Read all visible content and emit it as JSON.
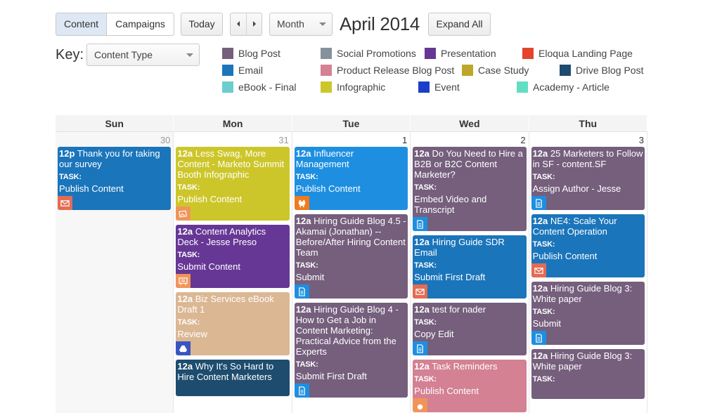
{
  "toolbar": {
    "view_tabs": [
      "Content",
      "Campaigns"
    ],
    "active_tab": "Content",
    "today_label": "Today",
    "prev_icon": "chevron-left-icon",
    "next_icon": "chevron-right-icon",
    "view_select": "Month",
    "period_title": "April 2014",
    "expand_label": "Expand All"
  },
  "key": {
    "label": "Key:",
    "select_value": "Content Type",
    "items": [
      {
        "label": "Blog Post",
        "color": "#755f7d"
      },
      {
        "label": "Email",
        "color": "#1b75bb"
      },
      {
        "label": "eBook - Final",
        "color": "#6ccdcf"
      },
      {
        "label": "Social Promotions",
        "color": "#85929c"
      },
      {
        "label": "Product Release Blog Post",
        "color": "#d38193"
      },
      {
        "label": "Infographic",
        "color": "#cdc62a"
      },
      {
        "label": "Presentation",
        "color": "#663795"
      },
      {
        "label": "Case Study",
        "color": "#bea62a"
      },
      {
        "label": "Event",
        "color": "#1c3ec9"
      },
      {
        "label": "Eloqua Landing Page",
        "color": "#e3452c"
      },
      {
        "label": "Drive Blog Post",
        "color": "#1d4c6e"
      },
      {
        "label": "Academy - Article",
        "color": "#62dec3"
      }
    ]
  },
  "calendar": {
    "days": [
      "Sun",
      "Mon",
      "Tue",
      "Wed",
      "Thu"
    ],
    "columns": [
      {
        "date": "30",
        "prev_month": true,
        "events": [
          {
            "time": "12p",
            "title": "Thank you for taking our survey",
            "task_label": "TASK:",
            "task": "Publish Content",
            "color": "#1b75bb",
            "icon": "email-icon",
            "icon_color": "#e36c54"
          }
        ]
      },
      {
        "date": "31",
        "prev_month": true,
        "events": [
          {
            "time": "12a",
            "title": "Less Swag, More Content - Marketo Summit Booth Infographic",
            "task_label": "TASK:",
            "task": "Publish Content",
            "color": "#cdc62a",
            "icon": "image-icon",
            "icon_color": "#f0955a"
          },
          {
            "time": "12a",
            "title": "Content Analytics Deck - Jesse Preso",
            "task_label": "TASK:",
            "task": "Submit Content",
            "color": "#663795",
            "icon": "presentation-icon",
            "icon_color": "#f0955a"
          },
          {
            "time": "12a",
            "title": "Biz Services eBook Draft 1",
            "task_label": "TASK:",
            "task": "Review",
            "color": "#dbb794",
            "icon": "google-drive-icon",
            "icon_color": "#3a55c2"
          },
          {
            "time": "12a",
            "title": "Why It's So Hard to Hire Content Marketers",
            "task_label": "",
            "task": "",
            "color": "#1d4c6e",
            "icon": "",
            "icon_color": ""
          }
        ]
      },
      {
        "date": "1",
        "prev_month": false,
        "events": [
          {
            "time": "12a",
            "title": "Influencer Management",
            "task_label": "TASK:",
            "task": "Publish Content",
            "color": "#1e8fe0",
            "icon": "social-icon",
            "icon_color": "#f07a1e"
          },
          {
            "time": "12a",
            "title": "Hiring Guide Blog 4.5 - Akamai (Jonathan) -- Before/After Hiring Content Team",
            "task_label": "TASK:",
            "task": "Submit",
            "color": "#755f7d",
            "icon": "document-icon",
            "icon_color": "#1e8fe0"
          },
          {
            "time": "12a",
            "title": "Hiring Guide Blog 4 - How to Get a Job in Content Marketing: Practical Advice from the Experts",
            "task_label": "TASK:",
            "task": "Submit First Draft",
            "color": "#755f7d",
            "icon": "document-icon",
            "icon_color": "#1e8fe0"
          }
        ]
      },
      {
        "date": "2",
        "prev_month": false,
        "events": [
          {
            "time": "12a",
            "title": "Do You Need to Hire a B2B or B2C Content Marketer?",
            "task_label": "TASK:",
            "task": "Embed Video and Transcript",
            "color": "#755f7d",
            "icon": "document-icon",
            "icon_color": "#1e8fe0"
          },
          {
            "time": "12a",
            "title": "Hiring Guide SDR Email",
            "task_label": "TASK:",
            "task": "Submit First Draft",
            "color": "#1b75bb",
            "icon": "email-icon",
            "icon_color": "#e36c54"
          },
          {
            "time": "12a",
            "title": "test for nader",
            "task_label": "TASK:",
            "task": "Copy Edit",
            "color": "#755f7d",
            "icon": "document-icon",
            "icon_color": "#1e8fe0"
          },
          {
            "time": "12a",
            "title": "Task Reminders",
            "task_label": "TASK:",
            "task": "Publish Content",
            "color": "#d38193",
            "icon": "circle-icon",
            "icon_color": "#f0955a"
          }
        ]
      },
      {
        "date": "3",
        "prev_month": false,
        "events": [
          {
            "time": "12a",
            "title": "25 Marketers to Follow in SF - content.SF",
            "task_label": "TASK:",
            "task": "Assign Author - Jesse",
            "color": "#755f7d",
            "icon": "document-icon",
            "icon_color": "#1e8fe0"
          },
          {
            "time": "12a",
            "title": "NE4: Scale Your Content Operation",
            "task_label": "TASK:",
            "task": "Publish Content",
            "color": "#1b75bb",
            "icon": "email-icon",
            "icon_color": "#e36c54"
          },
          {
            "time": "12a",
            "title": "Hiring Guide Blog 3: White paper",
            "task_label": "TASK:",
            "task": "Submit",
            "color": "#755f7d",
            "icon": "document-icon",
            "icon_color": "#1e8fe0"
          },
          {
            "time": "12a",
            "title": "Hiring Guide Blog 3: White paper",
            "task_label": "TASK:",
            "task": "",
            "color": "#755f7d",
            "icon": "",
            "icon_color": ""
          }
        ]
      }
    ]
  }
}
